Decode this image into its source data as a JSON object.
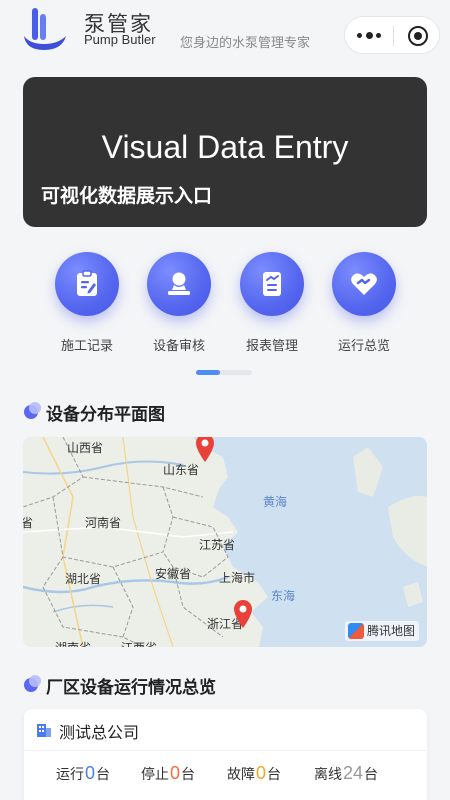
{
  "header": {
    "brand_cn": "泵管家",
    "brand_en": "Pump Butler",
    "slogan": "您身边的水泵管理专家"
  },
  "banner": {
    "title": "Visual Data Entry",
    "subtitle": "可视化数据展示入口"
  },
  "menu": [
    {
      "label": "施工记录",
      "icon": "clipboard-edit-icon"
    },
    {
      "label": "设备审核",
      "icon": "user-stamp-icon"
    },
    {
      "label": "报表管理",
      "icon": "report-icon"
    },
    {
      "label": "运行总览",
      "icon": "heart-handshake-icon"
    }
  ],
  "map_section": {
    "title": "设备分布平面图",
    "labels": {
      "shanxi": "山西省",
      "shandong": "山东省",
      "henan": "河南省",
      "jiangsu": "江苏省",
      "hubei": "湖北省",
      "anhui": "安徽省",
      "shanghai": "上海市",
      "zhejiang": "浙江省",
      "hunan": "湖南省",
      "jiangxi": "江西省",
      "edge_left": "省",
      "yellow_sea": "黄海",
      "east_sea": "东海"
    },
    "attribution": "腾讯地图"
  },
  "overview": {
    "title": "厂区设备运行情况总览",
    "company": "测试总公司",
    "stats": [
      {
        "label": "运行",
        "value": "0",
        "unit": "台",
        "color": "#4a7cf0"
      },
      {
        "label": "停止",
        "value": "0",
        "unit": "台",
        "color": "#ff6a3d"
      },
      {
        "label": "故障",
        "value": "0",
        "unit": "台",
        "color": "#f4a623"
      },
      {
        "label": "离线",
        "value": "24",
        "unit": "台",
        "color": "#999999"
      }
    ]
  }
}
